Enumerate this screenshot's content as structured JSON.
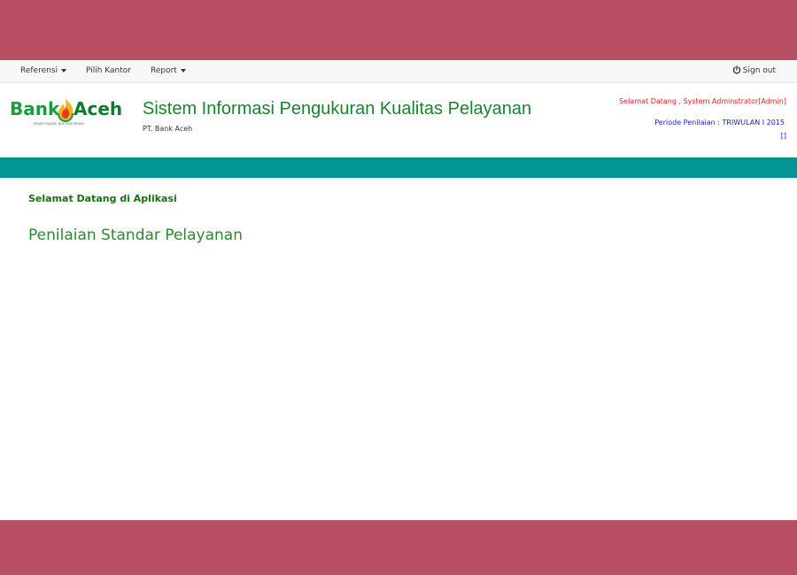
{
  "colors": {
    "frame_band": "#b84f63",
    "teal_bar": "#009590",
    "title_green": "#17862b",
    "welcome_red": "#e02020",
    "periode_blue": "#1a22c8"
  },
  "navbar": {
    "items": [
      {
        "label": "Referensi",
        "has_dropdown": true
      },
      {
        "label": "Pilih Kantor",
        "has_dropdown": false
      },
      {
        "label": "Report",
        "has_dropdown": true
      }
    ],
    "sign_out": {
      "label": "Sign out",
      "icon": "power-icon"
    }
  },
  "header": {
    "logo": {
      "word1": "Bank",
      "word2": "Aceh",
      "tagline": "Kepercayaan dan Kemitraan",
      "icon": "flame-icon"
    },
    "app_title": "Sistem Informasi Pengukuran Kualitas Pelayanan",
    "app_subtitle": "PT. Bank Aceh",
    "welcome_user": "Selamat Datang , System Adminstrator[Admin]",
    "periode": "Periode Penilaian : TRIWULAN I 2015",
    "periode_extra": "[]"
  },
  "main": {
    "heading": "Selamat Datang di Aplikasi",
    "title": "Penilaian Standar Pelayanan"
  }
}
